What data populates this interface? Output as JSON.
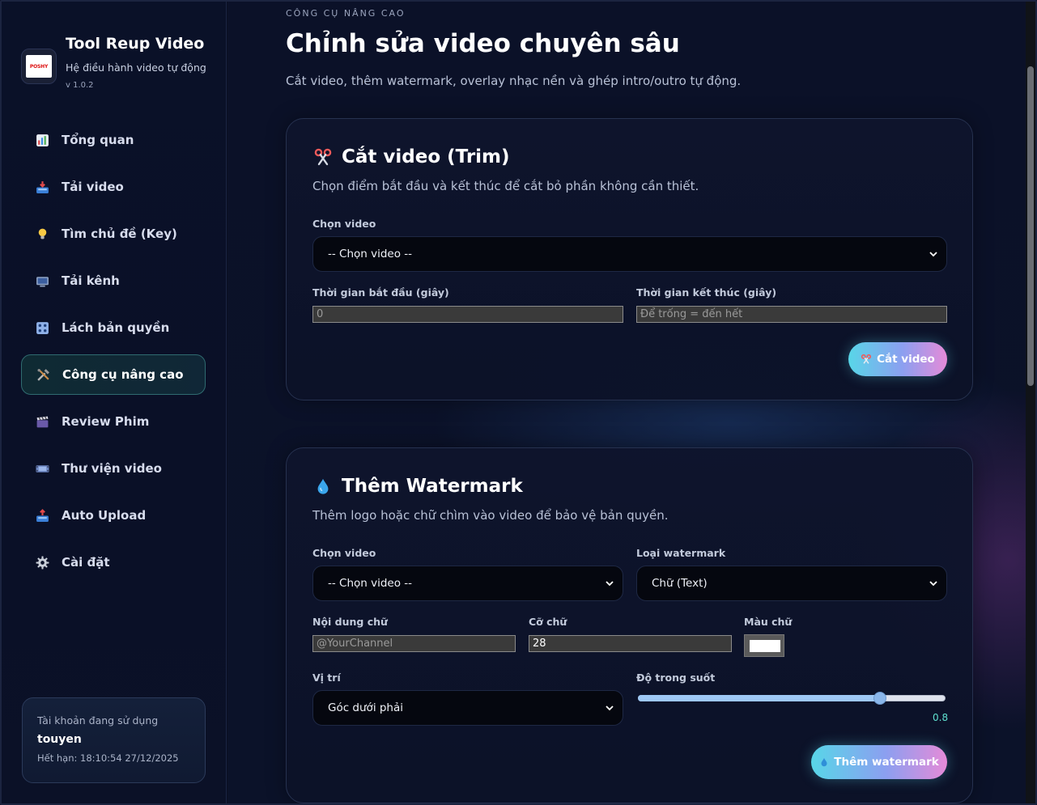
{
  "brand": {
    "title": "Tool Reup Video",
    "subtitle": "Hệ điều hành video tự động",
    "version": "v 1.0.2",
    "logo_text": "POSHY"
  },
  "nav": {
    "items": [
      {
        "label": "Tổng quan",
        "icon": "bar-chart-icon"
      },
      {
        "label": "Tải video",
        "icon": "inbox-tray-icon"
      },
      {
        "label": "Tìm chủ đề (Key)",
        "icon": "lightbulb-icon"
      },
      {
        "label": "Tải kênh",
        "icon": "tv-icon"
      },
      {
        "label": "Lách bản quyền",
        "icon": "control-knobs-icon"
      },
      {
        "label": "Công cụ nâng cao",
        "icon": "tools-icon",
        "active": true
      },
      {
        "label": "Review Phim",
        "icon": "clapper-icon"
      },
      {
        "label": "Thư viện video",
        "icon": "film-strip-icon"
      },
      {
        "label": "Auto Upload",
        "icon": "outbox-tray-icon"
      },
      {
        "label": "Cài đặt",
        "icon": "gear-icon"
      }
    ]
  },
  "account": {
    "label": "Tài khoản đang sử dụng",
    "username": "touyen",
    "expiry": "Hết hạn: 18:10:54 27/12/2025"
  },
  "header": {
    "eyebrow": "CÔNG CỤ NÂNG CAO",
    "title": "Chỉnh sửa video chuyên sâu",
    "description": "Cắt video, thêm watermark, overlay nhạc nền và ghép intro/outro tự động."
  },
  "trim": {
    "title": "Cắt video (Trim)",
    "icon": "scissors-icon",
    "description": "Chọn điểm bắt đầu và kết thúc để cắt bỏ phần không cần thiết.",
    "video_label": "Chọn video",
    "video_value": "-- Chọn video --",
    "start_label": "Thời gian bắt đầu (giây)",
    "start_placeholder": "0",
    "end_label": "Thời gian kết thúc (giây)",
    "end_placeholder": "Để trống = đến hết",
    "button": "Cắt video"
  },
  "watermark": {
    "title": "Thêm Watermark",
    "icon": "droplet-icon",
    "description": "Thêm logo hoặc chữ chìm vào video để bảo vệ bản quyền.",
    "video_label": "Chọn video",
    "video_value": "-- Chọn video --",
    "type_label": "Loại watermark",
    "type_value": "Chữ (Text)",
    "text_label": "Nội dung chữ",
    "text_placeholder": "@YourChannel",
    "size_label": "Cỡ chữ",
    "size_value": "28",
    "color_label": "Màu chữ",
    "color_value": "#ffffff",
    "position_label": "Vị trí",
    "position_value": "Góc dưới phải",
    "opacity_label": "Độ trong suốt",
    "opacity_value": "0.8",
    "opacity_fraction": 0.8,
    "button": "Thêm watermark"
  },
  "colors": {
    "accent_cyan": "#58d6e8",
    "accent_pink": "#e58bd8",
    "active_border": "#2f6b70",
    "slider_value": "#5ee0d0"
  }
}
